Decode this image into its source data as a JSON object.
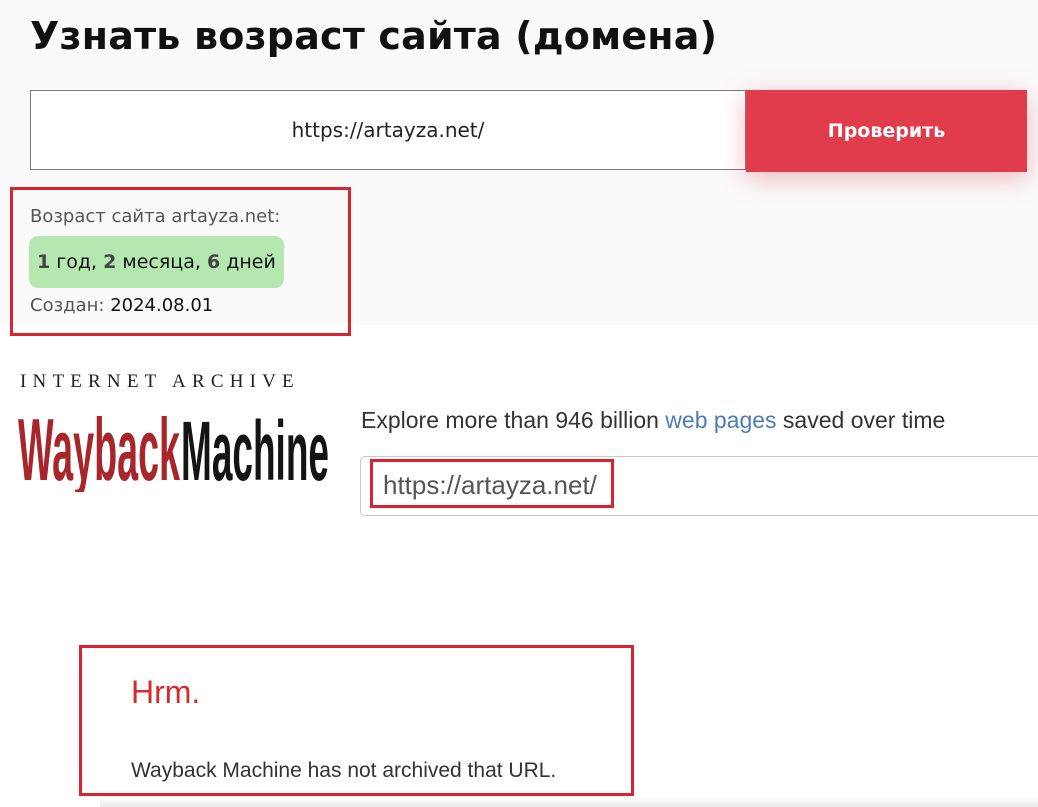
{
  "checker": {
    "title": "Узнать возраст сайта (домена)",
    "url_value": "https://artayza.net/",
    "check_label": "Проверить",
    "result": {
      "label": "Возраст сайта artayza.net:",
      "years_num": "1",
      "years_word": " год, ",
      "months_num": "2",
      "months_word": " месяца, ",
      "days_num": "6",
      "days_word": " дней",
      "created_label": "Создан:",
      "created_date": "2024.08.01"
    }
  },
  "wayback": {
    "ia_text": "INTERNET ARCHIVE",
    "logo_word_1": "Wayback",
    "logo_word_2": "Machine",
    "explore_prefix": "Explore more than 946 billion ",
    "explore_link": "web pages",
    "explore_suffix": " saved over time",
    "search_value": "https://artayza.net/",
    "error_title": "Hrm.",
    "error_message": "Wayback Machine has not archived that URL."
  },
  "colors": {
    "accent_red": "#e03c4c",
    "highlight_red": "#d9242f",
    "badge_green": "#b5e8b1",
    "logo_red": "#a8262b",
    "link_blue": "#4a7cb5"
  }
}
